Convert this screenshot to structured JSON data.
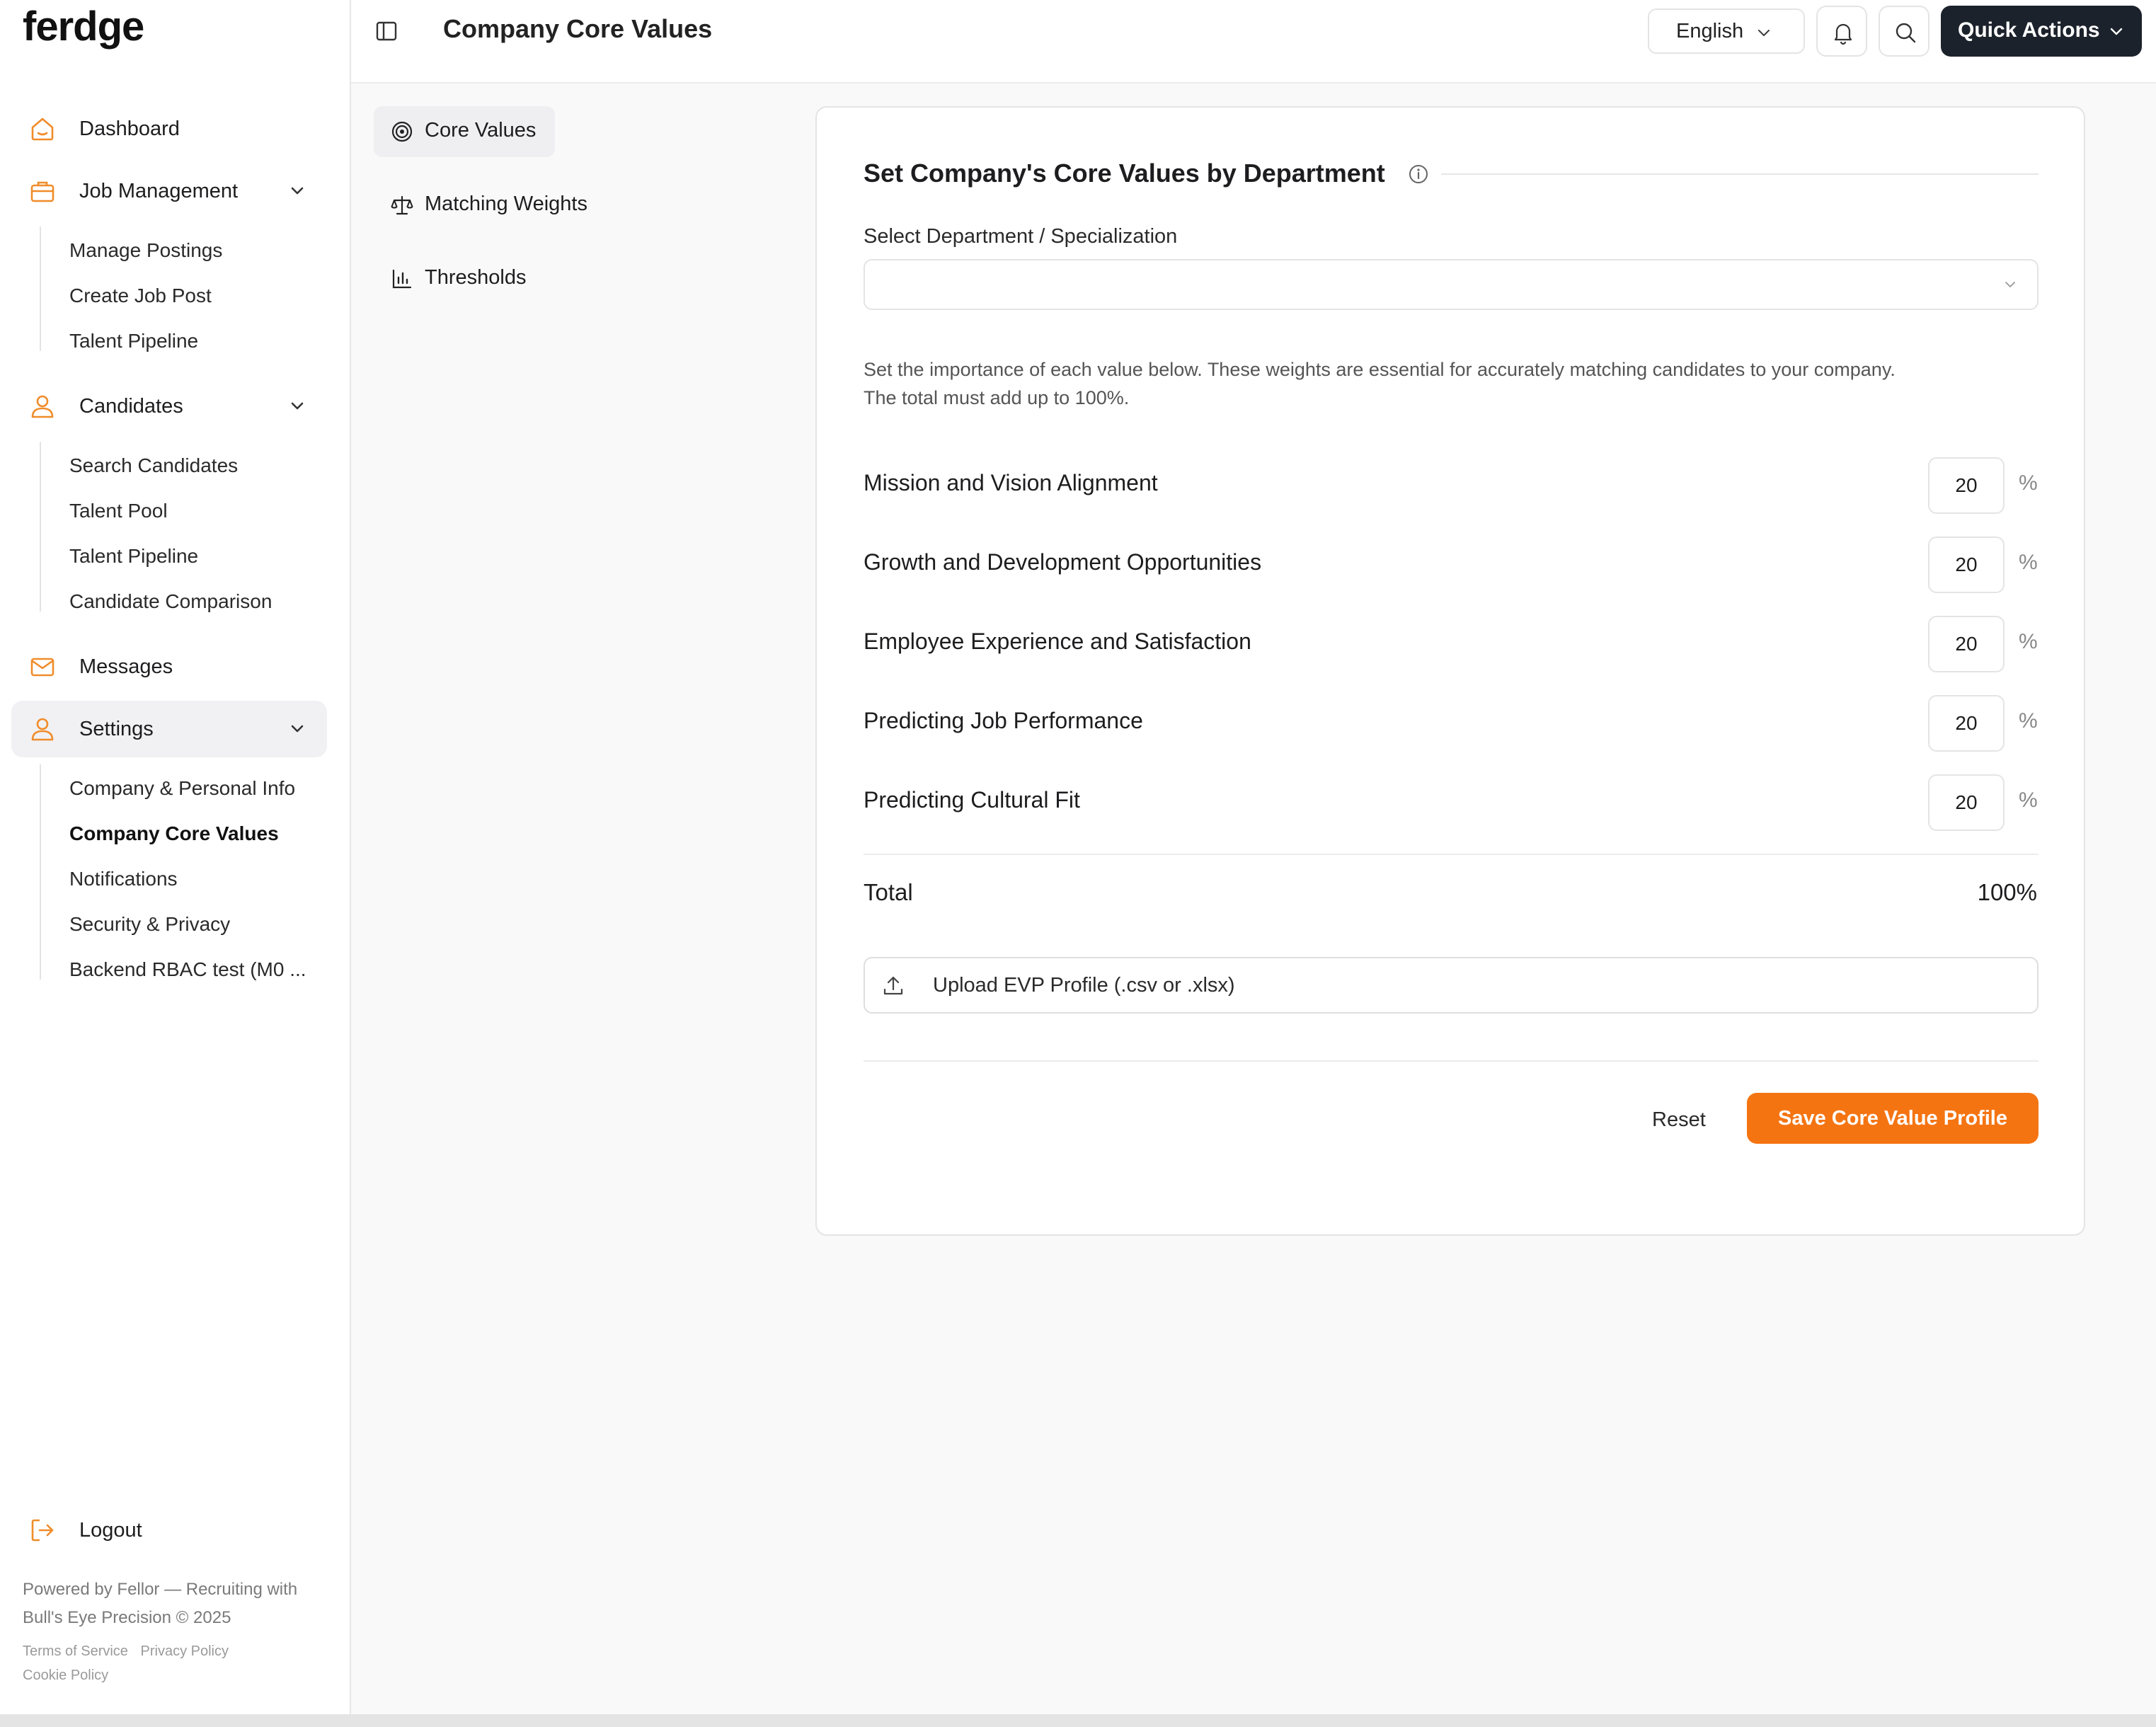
{
  "brand": {
    "logo": "ferdge"
  },
  "sidebar": {
    "dashboard": "Dashboard",
    "job_management": {
      "label": "Job Management",
      "items": [
        "Manage Postings",
        "Create Job Post",
        "Talent Pipeline"
      ]
    },
    "candidates": {
      "label": "Candidates",
      "items": [
        "Search Candidates",
        "Talent Pool",
        "Talent Pipeline",
        "Candidate Comparison"
      ]
    },
    "messages": "Messages",
    "settings": {
      "label": "Settings",
      "items": [
        "Company & Personal Info",
        "Company Core Values",
        "Notifications",
        "Security & Privacy",
        "Backend RBAC test (M0 ..."
      ],
      "active_item": "Company Core Values"
    },
    "logout": "Logout",
    "footer": {
      "line1": "Powered by Fellor — Recruiting with",
      "line2": "Bull's Eye Precision © 2025",
      "terms": "Terms of Service",
      "privacy": "Privacy Policy",
      "cookie": "Cookie Policy"
    }
  },
  "header": {
    "title": "Company Core Values",
    "language": "English",
    "quick_actions": "Quick Actions"
  },
  "subnav": {
    "items": [
      "Core Values",
      "Matching Weights",
      "Thresholds"
    ],
    "active": "Core Values"
  },
  "card": {
    "title": "Set Company's Core Values by Department",
    "department_label": "Select Department / Specialization",
    "department_value": "",
    "help_line1": "Set the importance of each value below. These weights are essential for accurately matching candidates to your company.",
    "help_line2": "The total must add up to 100%.",
    "values": [
      {
        "label": "Mission and Vision Alignment",
        "value": "20"
      },
      {
        "label": "Growth and Development Opportunities",
        "value": "20"
      },
      {
        "label": "Employee Experience and Satisfaction",
        "value": "20"
      },
      {
        "label": "Predicting Job Performance",
        "value": "20"
      },
      {
        "label": "Predicting Cultural Fit",
        "value": "20"
      }
    ],
    "percent_symbol": "%",
    "total_label": "Total",
    "total_value": "100%",
    "upload_label": "Upload EVP Profile (.csv or .xlsx)",
    "reset_label": "Reset",
    "save_label": "Save Core Value Profile"
  },
  "colors": {
    "accent": "#f57412",
    "dark_button": "#1c222b",
    "icon_orange": "#f08c2a"
  },
  "icons": [
    "home-icon",
    "briefcase-icon",
    "user-icon",
    "mail-icon",
    "settings-user-icon",
    "logout-icon",
    "sidebar-toggle-icon",
    "bell-icon",
    "search-icon",
    "target-icon",
    "scale-icon",
    "bar-chart-icon",
    "info-icon",
    "upload-icon",
    "chevron-down-icon"
  ]
}
